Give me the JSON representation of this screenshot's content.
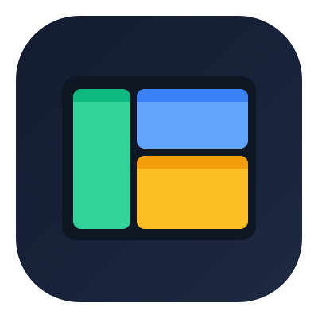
{
  "icon": {
    "name": "layout-dashboard-icon",
    "background": {
      "from": "#141c2f",
      "to": "#1e2a43"
    },
    "board": {
      "color": "#0f1624"
    },
    "panels": {
      "left": {
        "name": "green-panel",
        "body_color": "#34d399",
        "header_color": "#10b981"
      },
      "top_right": {
        "name": "blue-panel",
        "body_color": "#60a5fa",
        "header_color": "#3b82f6"
      },
      "bottom_right": {
        "name": "yellow-panel",
        "body_color": "#fbbf24",
        "header_color": "#f59e0b"
      }
    }
  }
}
